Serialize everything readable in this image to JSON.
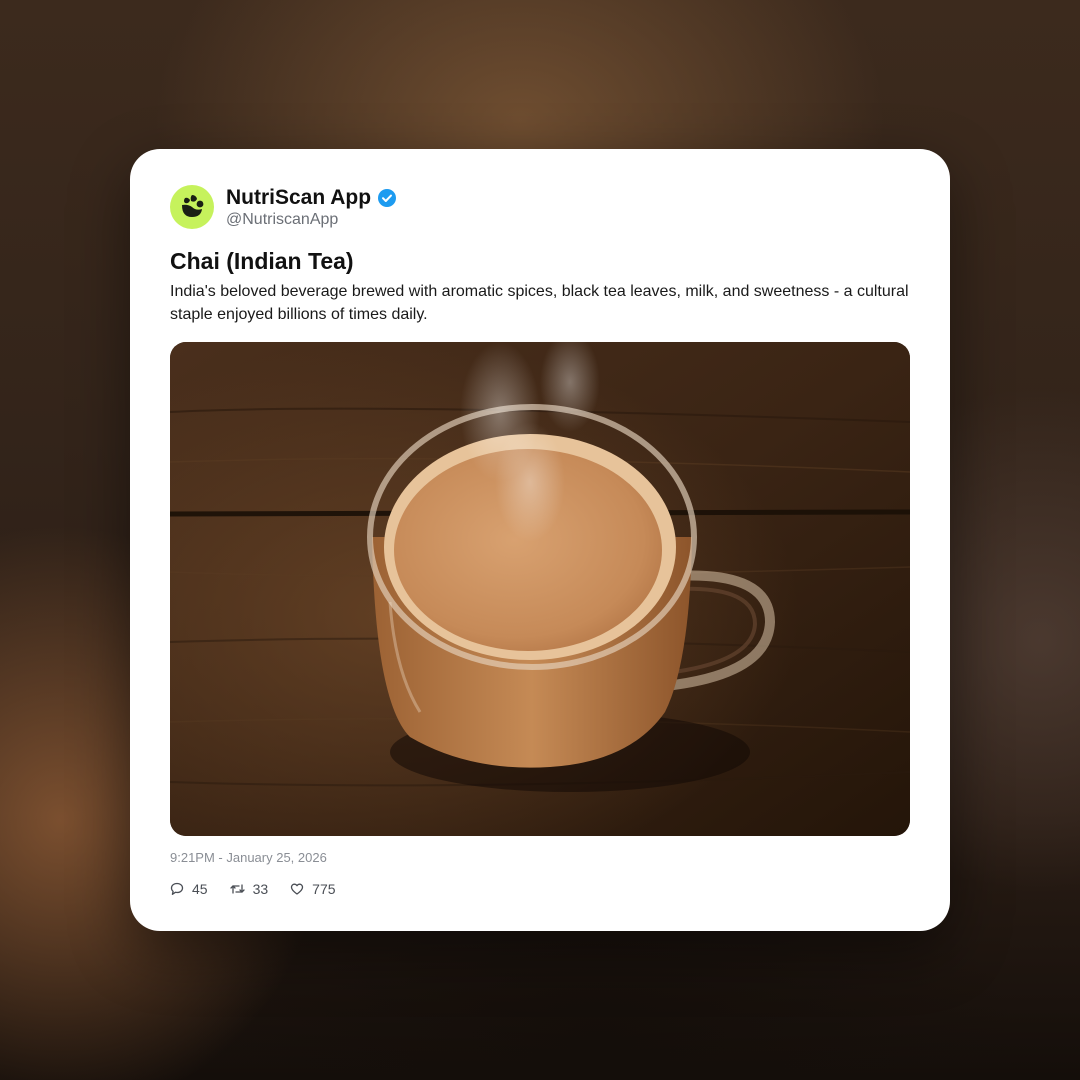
{
  "post": {
    "display_name": "NutriScan App",
    "handle": "@NutriscanApp",
    "verified": true,
    "title": "Chai (Indian Tea)",
    "description": "India's beloved beverage brewed with aromatic spices, black tea leaves, milk, and sweetness - a cultural staple enjoyed billions of times daily.",
    "image_icon": "photo-of-chai-in-glass-mug",
    "timestamp": "9:21PM - January 25, 2026",
    "stats": {
      "replies": "45",
      "retweets": "33",
      "likes": "775"
    }
  },
  "colors": {
    "avatar_bg": "#c6f25c",
    "verified_badge": "#1d9bf0",
    "card_bg": "#ffffff"
  },
  "icons": {
    "avatar": "nutriscan-leaf-logo-icon",
    "verified": "verified-badge-icon",
    "reply": "comment-icon",
    "retweet": "retweet-icon",
    "like": "heart-icon"
  }
}
